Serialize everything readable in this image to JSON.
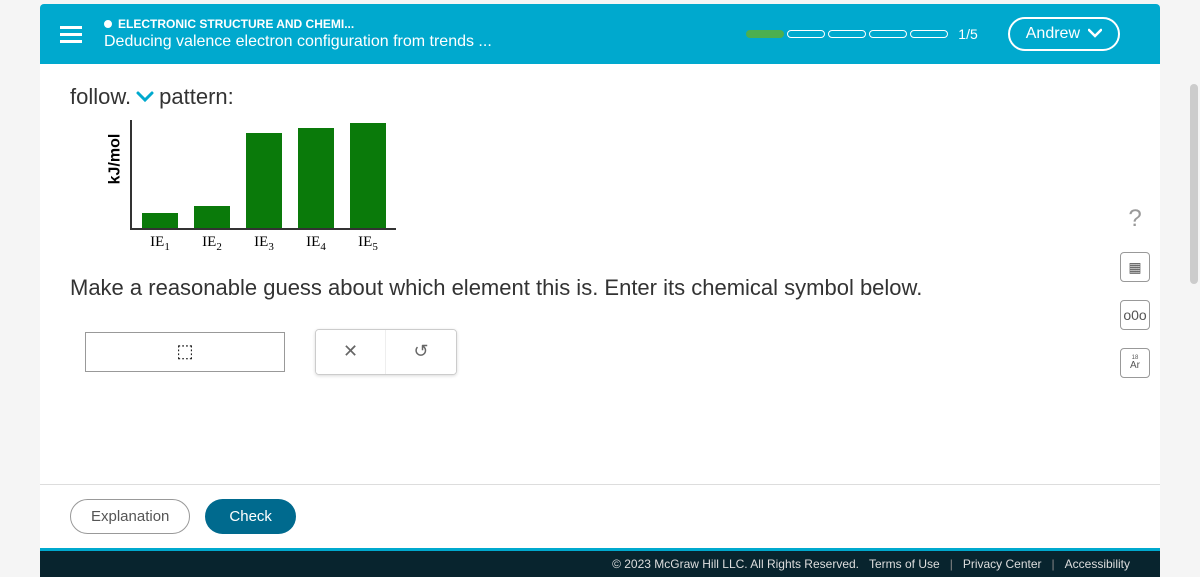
{
  "header": {
    "category": "ELECTRONIC STRUCTURE AND CHEMI...",
    "subtitle": "Deducing valence electron configuration from trends ...",
    "progress_text": "1/5",
    "user_name": "Andrew"
  },
  "content": {
    "intro_left": "follow.",
    "intro_right": "pattern:",
    "question": "Make a reasonable guess about which element this is. Enter its chemical symbol below.",
    "answer_value": "⬚"
  },
  "chart_data": {
    "type": "bar",
    "categories": [
      "IE₁",
      "IE₂",
      "IE₃",
      "IE₄",
      "IE₅"
    ],
    "values": [
      15,
      22,
      95,
      100,
      105
    ],
    "ylabel": "kJ/mol",
    "xlabel": "",
    "ylim": [
      0,
      110
    ]
  },
  "tools": {
    "clear": "✕",
    "undo": "↺",
    "help": "?",
    "calc": "▦",
    "chart": "o0o",
    "periodic": "Ar"
  },
  "buttons": {
    "explanation": "Explanation",
    "check": "Check"
  },
  "footer": {
    "copyright": "© 2023 McGraw Hill LLC. All Rights Reserved.",
    "terms": "Terms of Use",
    "privacy": "Privacy Center",
    "accessibility": "Accessibility"
  }
}
